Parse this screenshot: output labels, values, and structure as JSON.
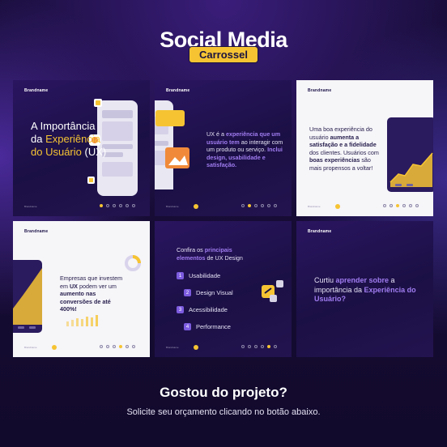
{
  "header": {
    "title": "Social Media",
    "badge": "Carrossel"
  },
  "brand": "Brandname",
  "card1": {
    "line1": "A Importância",
    "line2_a": "da ",
    "line2_b": "Experiência",
    "line3": "do Usuário",
    "line3_b": " (UX)"
  },
  "card2": {
    "t1": "UX é a ",
    "t2": "experiência que um usuário tem",
    "t3": " ao interagir com um produto ou serviço. ",
    "t4": "Inclui design, usabilidade e satisfação."
  },
  "card3": {
    "t1": "Uma boa experiência do usuário ",
    "t2": "aumenta a satisfação e a fidelidade",
    "t3": " dos clientes. Usuários com ",
    "t4": "boas experiências",
    "t5": " são mais propensos a voltar!"
  },
  "card4": {
    "t1": "Empresas que investem em ",
    "t2": "UX",
    "t3": " podem ver um ",
    "t4": "aumento nas conversões de até 400%!"
  },
  "card5": {
    "t1": "Confira os ",
    "t2": "principais elementos",
    "t3": " de UX Design",
    "items": [
      {
        "num": "1",
        "label": "Usabilidade"
      },
      {
        "num": "2",
        "label": "Design Visual"
      },
      {
        "num": "3",
        "label": "Acessibilidade"
      },
      {
        "num": "4",
        "label": "Performance"
      }
    ]
  },
  "card6": {
    "t1": "Curtiu ",
    "t2": "aprender sobre",
    "t3": " a importância da ",
    "t4": "Experiência do Usuário?"
  },
  "footer": {
    "title": "Gostou do projeto?",
    "subtitle": "Solicite seu orçamento clicando no botão abaixo."
  },
  "colors": {
    "accent_yellow": "#f6c433",
    "accent_purple": "#a07cf0",
    "dark_bg": "#1b1045",
    "light_bg": "#f6f5f8"
  }
}
